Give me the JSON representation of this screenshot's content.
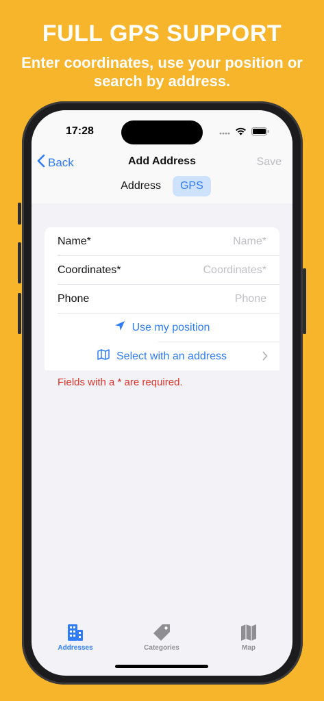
{
  "promo": {
    "headline": "FULL GPS SUPPORT",
    "subline": "Enter coordinates, use your position or search by address."
  },
  "statusbar": {
    "time": "17:28"
  },
  "navbar": {
    "back_label": "Back",
    "title": "Add Address",
    "save_label": "Save"
  },
  "segment": {
    "items": [
      "Address",
      "GPS"
    ],
    "selected": "GPS"
  },
  "form": {
    "name_label": "Name*",
    "name_placeholder": "Name*",
    "coordinates_label": "Coordinates*",
    "coordinates_placeholder": "Coordinates*",
    "phone_label": "Phone",
    "phone_placeholder": "Phone",
    "use_position_label": "Use my position",
    "select_address_label": "Select with an address"
  },
  "required_note": "Fields with a * are required.",
  "tabbar": {
    "items": [
      {
        "label": "Addresses",
        "icon": "building-icon"
      },
      {
        "label": "Categories",
        "icon": "tag-icon"
      },
      {
        "label": "Map",
        "icon": "map-icon"
      }
    ],
    "active": "Addresses"
  },
  "colors": {
    "background": "#F7B52C",
    "accent": "#2F7CF6",
    "error": "#E0342B"
  }
}
